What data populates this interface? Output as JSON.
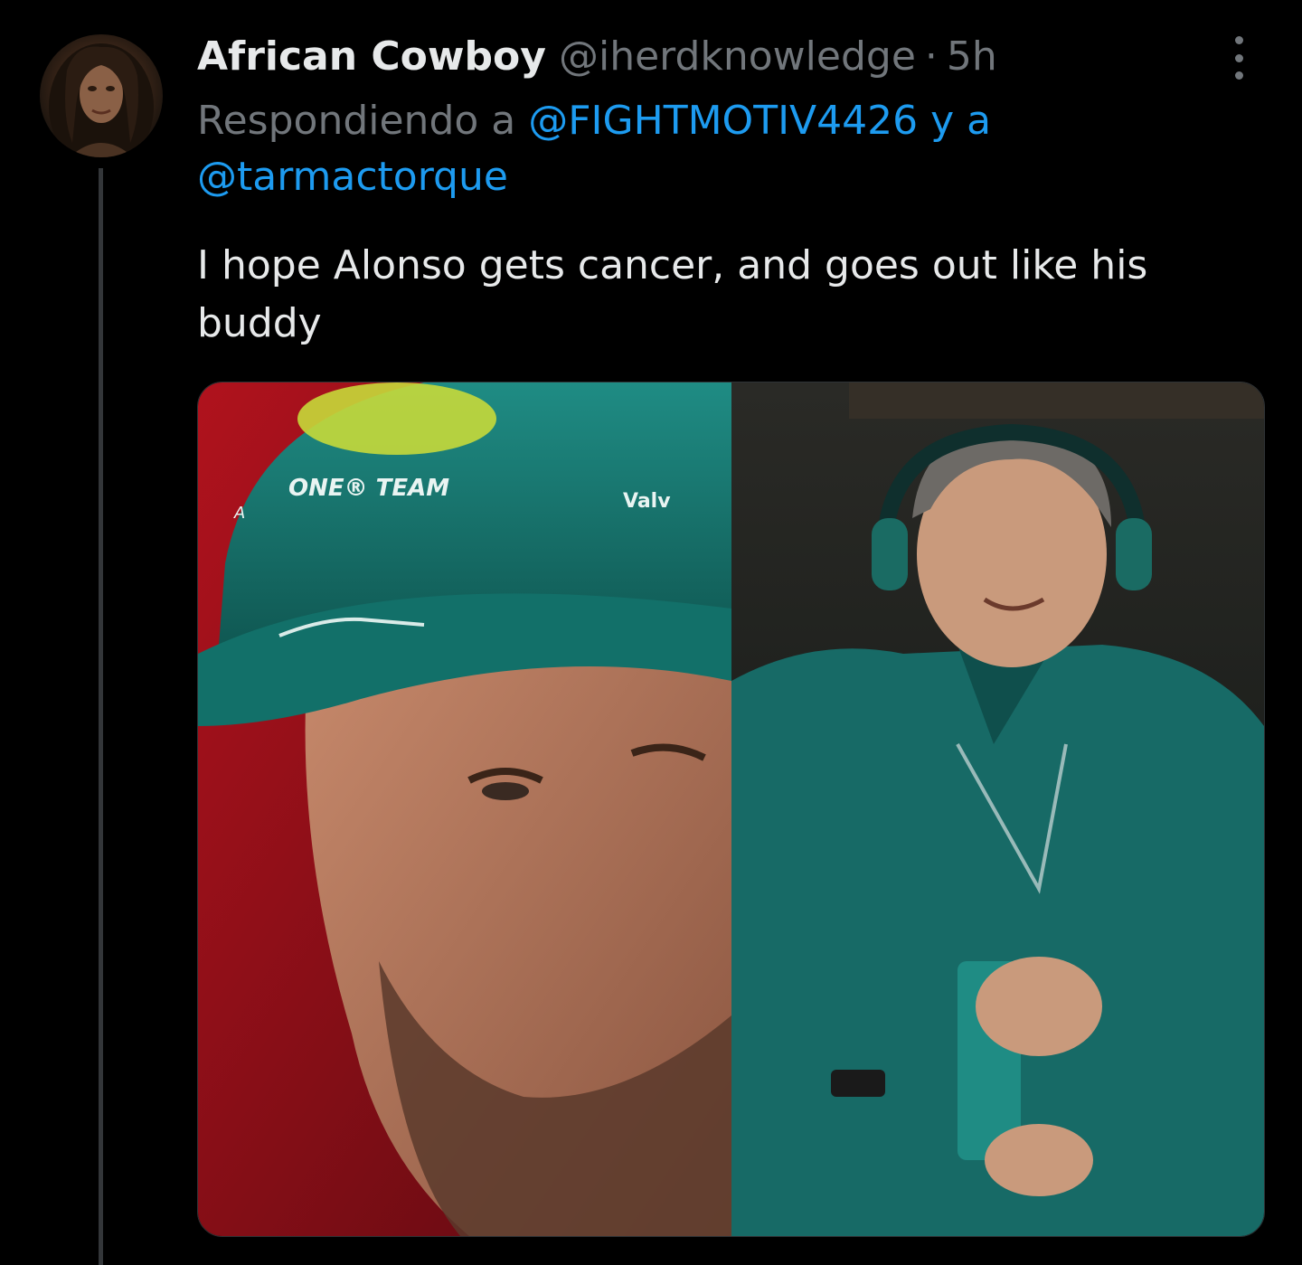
{
  "tweet": {
    "display_name": "African Cowboy",
    "handle": "@iherdknowledge",
    "separator": "·",
    "time": "5h",
    "replying_prefix": "Respondiendo a",
    "reply_to_1": "@FIGHTMOTIV4426",
    "reply_join": "y a",
    "reply_to_2": "@tarmactorque",
    "text": "I hope Alonso gets cancer, and goes out like his buddy"
  },
  "media": {
    "cap_text": "ONE® TEAM",
    "cap_text_prefix": "A",
    "sponsor_text": "Valv"
  },
  "icons": {
    "more": "more-options-icon",
    "avatar": "profile-avatar"
  },
  "colors": {
    "background": "#000000",
    "text_primary": "#e7e9ea",
    "text_secondary": "#71767b",
    "link": "#1d9bf0",
    "thread_line": "#333639"
  }
}
